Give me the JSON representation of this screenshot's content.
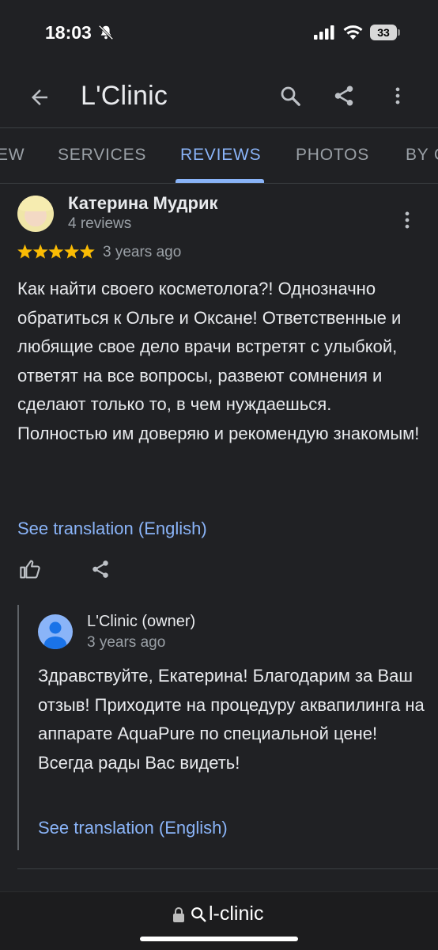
{
  "status_bar": {
    "time": "18:03",
    "battery": "33"
  },
  "app_bar": {
    "title": "L'Clinic"
  },
  "tabs": [
    {
      "label": "EW"
    },
    {
      "label": "SERVICES"
    },
    {
      "label": "REVIEWS",
      "active": true
    },
    {
      "label": "PHOTOS"
    },
    {
      "label": "BY C"
    }
  ],
  "review": {
    "author": "Катерина Мудрик",
    "author_reviews": "4 reviews",
    "rating": 5,
    "date": "3 years ago",
    "text": "Как найти своего косметолога?! Однозначно обратиться к Ольге и Оксане! Ответственные и любящие свое дело врачи встретят с улыбкой, ответят на все вопросы, развеют сомнения и сделают только то, в чем нуждаешься. Полностью им доверяю и рекомендую знакомым!",
    "see_translation": "See translation (English)"
  },
  "owner_reply": {
    "author": "L'Clinic (owner)",
    "date": "3 years ago",
    "text": "Здравствуйте, Екатерина! Благодарим за Ваш отзыв! Приходите на процедуру аквапилинга на аппарате AquaPure по специальной цене! Всегда рады Вас видеть!",
    "see_translation": "See translation (English)"
  },
  "url_bar": {
    "text": "l-clinic"
  },
  "colors": {
    "background": "#202124",
    "accent": "#8ab4f8",
    "star": "#fbbc04",
    "muted": "#9aa0a6"
  }
}
